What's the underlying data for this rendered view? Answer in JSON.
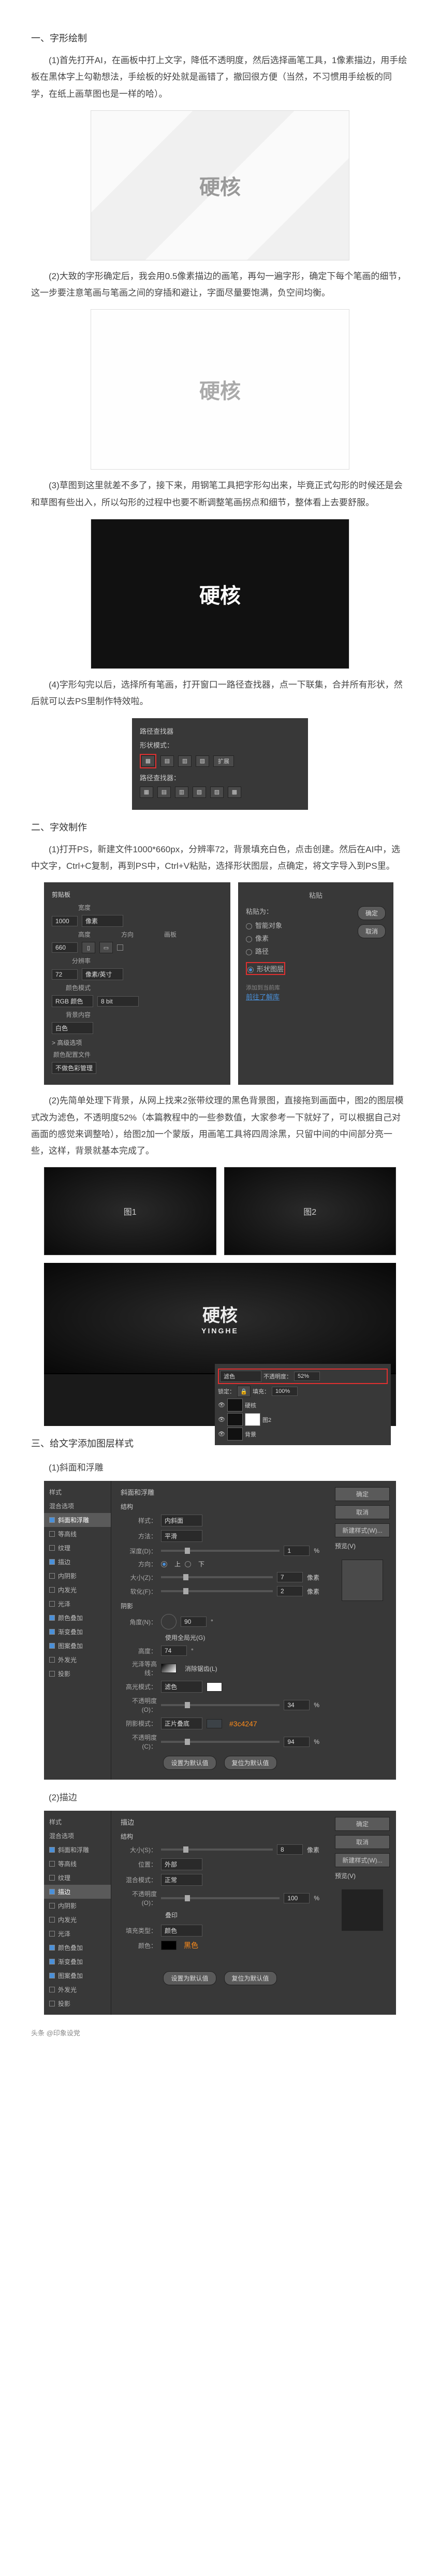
{
  "section1_title": "一、字形绘制",
  "step1": "(1)首先打开AI，在画板中打上文字，降低不透明度，然后选择画笔工具，1像素描边，用手绘板在黑体字上勾勒想法，手绘板的好处就是画错了，撤回很方便（当然，不习惯用手绘板的同学，在纸上画草图也是一样的哈）。",
  "step2": "(2)大致的字形确定后，我会用0.5像素描边的画笔，再勾一遍字形，确定下每个笔画的细节，这一步要注意笔画与笔画之间的穿插和避让，字面尽量要饱满，负空间均衡。",
  "step3": "(3)草图到这里就差不多了，接下来，用钢笔工具把字形勾出来，毕竟正式勾形的时候还是会和草图有些出入，所以勾形的过程中也要不断调整笔画拐点和细节，整体看上去要舒服。",
  "step4": "(4)字形勾完以后，选择所有笔画，打开窗口一路径查找器，点一下联集，合并所有形状，然后就可以去PS里制作特效啦。",
  "pathfinder": {
    "title": "路径查找器",
    "shape_mode": "形状模式：",
    "expand": "扩展",
    "path_find": "路径查找器："
  },
  "section2_title": "二、字效制作",
  "step2_1": "(1)打开PS，新建文件1000*660px，分辨率72，背景填充白色，点击创建。然后在AI中，选中文字，Ctrl+C复制，再到PS中，Ctrl+V粘贴，选择形状图层，点确定，将文字导入到PS里。",
  "newdoc": {
    "preset": "剪贴板",
    "w_label": "宽度",
    "w": "1000",
    "unit": "像素",
    "h_label": "高度",
    "h": "660",
    "orient": "方向",
    "artboard": "画板",
    "res_label": "分辨率",
    "res": "72",
    "res_unit": "像素/英寸",
    "mode_label": "颜色模式",
    "mode": "RGB 颜色",
    "bit": "8 bit",
    "bg_label": "背景内容",
    "bg": "白色",
    "adv": "> 高级选项",
    "profile_label": "颜色配置文件",
    "profile": "不做色彩管理"
  },
  "paste": {
    "title": "粘贴",
    "as": "粘贴为：",
    "o1": "智能对象",
    "o2": "像素",
    "o3": "路径",
    "o4": "形状图层",
    "link": "添加到当前库",
    "liblink": "前往了解库",
    "ok": "确定",
    "cancel": "取消"
  },
  "step2_2": "(2)先简单处理下背景，从网上找来2张带纹理的黑色背景图，直接拖到画面中，图2的图层模式改为滤色，不透明度52%（本篇教程中的一些参数值，大家参考一下就好了，可以根据自己对画面的感觉来调整哈），给图2加一个蒙版，用画笔工具将四周涂黑，只留中间的中间部分亮一些，这样，背景就基本完成了。",
  "bg1": "图1",
  "bg2": "图2",
  "logo_text": "硬核",
  "logo_sub": "YINGHE",
  "layers": {
    "mode": "滤色",
    "opacity_label": "不透明度：",
    "opacity": "52%",
    "lock": "锁定：",
    "fill_label": "填充：",
    "fill": "100%",
    "l1": "硬核",
    "l2": "图2",
    "l3": "背景"
  },
  "section3_title": "三、给文字添加图层样式",
  "sub3_1": "(1)斜面和浮雕",
  "sub3_2": "(2)描边",
  "bevel": {
    "title": "斜面和浮雕",
    "struct": "结构",
    "style_l": "样式：",
    "style_v": "内斜面",
    "method_l": "方法：",
    "method_v": "平滑",
    "depth_l": "深度(D)：",
    "depth_v": "1",
    "dir_l": "方向：",
    "dir_up": "上",
    "dir_down": "下",
    "size_l": "大小(Z)：",
    "size_v": "7",
    "px": "像素",
    "soft_l": "软化(F)：",
    "soft_v": "2",
    "shade": "阴影",
    "angle_l": "角度(N)：",
    "angle_v": "90",
    "global": "使用全局光(G)",
    "alt_l": "高度：",
    "alt_v": "74",
    "gloss_l": "光泽等高线：",
    "anti": "消除锯齿(L)",
    "hm_l": "高光模式：",
    "hm_v": "滤色",
    "ho_l": "不透明度(O)：",
    "ho_v": "34",
    "sm_l": "阴影模式：",
    "sm_v": "正片叠底",
    "so_l": "不透明度(C)：",
    "so_v": "94",
    "color_code": "#3c4247",
    "default": "设置为默认值",
    "reset": "复位为默认值",
    "ok": "确定",
    "cancel": "取消",
    "new": "新建样式(W)...",
    "preview": "预览(V)"
  },
  "fx_list": {
    "i0": "样式",
    "i1": "混合选项",
    "i2": "斜面和浮雕",
    "i3": "等高线",
    "i4": "纹理",
    "i5": "描边",
    "i6": "内阴影",
    "i7": "内发光",
    "i8": "光泽",
    "i9": "颜色叠加",
    "i10": "渐变叠加",
    "i11": "图案叠加",
    "i12": "外发光",
    "i13": "投影"
  },
  "stroke": {
    "title": "描边",
    "struct": "结构",
    "size_l": "大小(S)：",
    "size_v": "8",
    "px": "像素",
    "pos_l": "位置：",
    "pos_v": "外部",
    "blend_l": "混合模式：",
    "blend_v": "正常",
    "op_l": "不透明度(O)：",
    "op_v": "100",
    "over": "叠印",
    "fill_l": "填充类型：",
    "fill_v": "颜色",
    "color_l": "颜色：",
    "color_v": "黑色"
  },
  "footer": "头条 @印象设党"
}
